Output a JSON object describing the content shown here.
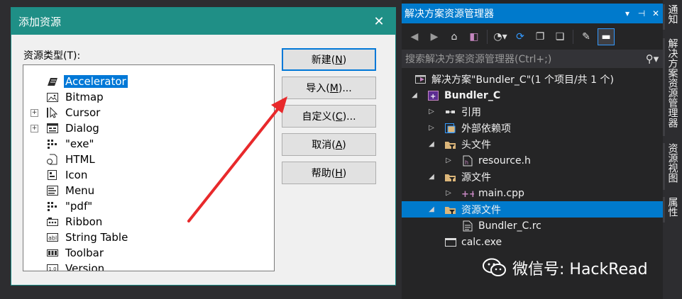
{
  "dialog": {
    "title": "添加资源",
    "resource_type_label": "资源类型(T):",
    "tree_items": [
      {
        "label": "Accelerator",
        "icon": "accelerator-icon",
        "expandable": false,
        "selected": true
      },
      {
        "label": "Bitmap",
        "icon": "bitmap-icon",
        "expandable": false,
        "selected": false
      },
      {
        "label": "Cursor",
        "icon": "cursor-icon",
        "expandable": true,
        "selected": false
      },
      {
        "label": "Dialog",
        "icon": "dialog-icon",
        "expandable": true,
        "selected": false
      },
      {
        "label": "\"exe\"",
        "icon": "custom-resource-icon",
        "expandable": false,
        "selected": false
      },
      {
        "label": "HTML",
        "icon": "html-icon",
        "expandable": false,
        "selected": false
      },
      {
        "label": "Icon",
        "icon": "icon-resource-icon",
        "expandable": false,
        "selected": false
      },
      {
        "label": "Menu",
        "icon": "menu-icon",
        "expandable": false,
        "selected": false
      },
      {
        "label": "\"pdf\"",
        "icon": "custom-resource-icon",
        "expandable": false,
        "selected": false
      },
      {
        "label": "Ribbon",
        "icon": "ribbon-icon",
        "expandable": false,
        "selected": false
      },
      {
        "label": "String Table",
        "icon": "string-table-icon",
        "expandable": false,
        "selected": false
      },
      {
        "label": "Toolbar",
        "icon": "toolbar-icon",
        "expandable": false,
        "selected": false
      },
      {
        "label": "Version",
        "icon": "version-icon",
        "expandable": false,
        "selected": false
      }
    ],
    "buttons": {
      "new": {
        "text": "新建",
        "key": "N"
      },
      "import": {
        "text": "导入",
        "key": "M",
        "suffix": "..."
      },
      "custom": {
        "text": "自定义",
        "key": "C",
        "suffix": "..."
      },
      "cancel": {
        "text": "取消",
        "key": "A"
      },
      "help": {
        "text": "帮助",
        "key": "H"
      }
    }
  },
  "solution_explorer": {
    "title": "解决方案资源管理器",
    "search_placeholder": "搜索解决方案资源管理器(Ctrl+;)",
    "rows": [
      {
        "label": "解决方案\"Bundler_C\"(1 个项目/共 1 个)",
        "icon": "solution-icon",
        "arrow": "",
        "level": 0,
        "bold": false,
        "selected": false
      },
      {
        "label": "Bundler_C",
        "icon": "project-icon",
        "arrow": "expanded",
        "level": 1,
        "bold": true,
        "selected": false
      },
      {
        "label": "引用",
        "icon": "references-icon",
        "arrow": "collapsed",
        "level": 2,
        "bold": false,
        "selected": false
      },
      {
        "label": "外部依赖项",
        "icon": "external-deps-icon",
        "arrow": "collapsed",
        "level": 2,
        "bold": false,
        "selected": false
      },
      {
        "label": "头文件",
        "icon": "folder-filter-icon",
        "arrow": "expanded",
        "level": 2,
        "bold": false,
        "selected": false
      },
      {
        "label": "resource.h",
        "icon": "header-file-icon",
        "arrow": "collapsed",
        "level": 3,
        "bold": false,
        "selected": false
      },
      {
        "label": "源文件",
        "icon": "folder-filter-icon",
        "arrow": "expanded",
        "level": 2,
        "bold": false,
        "selected": false
      },
      {
        "label": "main.cpp",
        "icon": "cpp-file-icon",
        "arrow": "collapsed",
        "level": 3,
        "bold": false,
        "selected": false
      },
      {
        "label": "资源文件",
        "icon": "folder-filter-icon",
        "arrow": "expanded",
        "level": 2,
        "bold": false,
        "selected": true
      },
      {
        "label": "Bundler_C.rc",
        "icon": "rc-file-icon",
        "arrow": "",
        "level": 3,
        "bold": false,
        "selected": false
      },
      {
        "label": "calc.exe",
        "icon": "file-icon",
        "arrow": "",
        "level": 2,
        "bold": false,
        "selected": false
      }
    ]
  },
  "side_tabs": [
    "通知",
    "解决方案资源管理器",
    "资源视图",
    "属性"
  ],
  "watermark": "微信号: HackRead",
  "colors": {
    "dialog_title": "#1f8f86",
    "vs_accent": "#007acc",
    "selection": "#0078d7",
    "annotation_arrow": "#e8292b"
  }
}
